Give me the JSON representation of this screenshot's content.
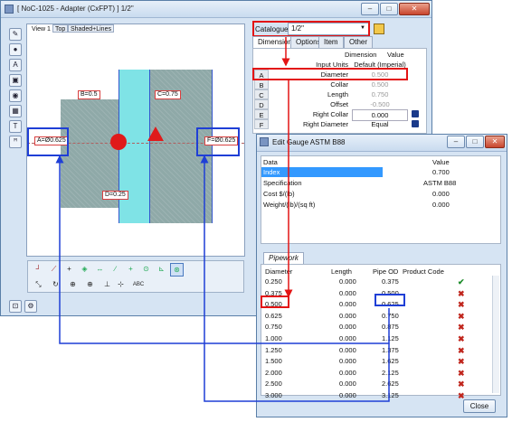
{
  "main_window": {
    "title": "[ NoC-1025 - Adapter (CxFPT) ] 1/2\"",
    "min_label": "–",
    "max_label": "□",
    "close_label": "✕"
  },
  "toolbar_icons": [
    "draw-icon",
    "sphere-icon",
    "text-icon",
    "camera-icon",
    "ball-icon",
    "grid-icon",
    "paint-icon",
    "brush-icon"
  ],
  "view": {
    "tabs": [
      "View 1",
      "Top",
      "Shaded+Lines"
    ],
    "dims": {
      "b": "B=0.5",
      "c": "C=0.75",
      "a": "A=Ø0.625",
      "f": "F=Ø0.625",
      "d": "D=0.25"
    }
  },
  "bottom_tools_row1": [
    "┘",
    "⟋",
    "+",
    "◈",
    "↔",
    "∕",
    "+",
    "⊙",
    "⊾",
    "⊛"
  ],
  "bottom_tools_row2": [
    "⤡",
    "↻",
    "⊕",
    "⊕",
    "⊥",
    "⊹",
    "ABC"
  ],
  "catalogue": {
    "label": "Catalogue",
    "value": "1/2\""
  },
  "dim_tabs": [
    "Dimensions",
    "Options",
    "Item",
    "Other"
  ],
  "dim_table": {
    "header_dimension": "Dimension",
    "header_value": "Value",
    "rows": [
      {
        "key": "",
        "name": "Input Units",
        "value": "Default (Imperial)"
      },
      {
        "key": "A",
        "name": "Diameter",
        "value": "0.500"
      },
      {
        "key": "B",
        "name": "Collar",
        "value": "0.500"
      },
      {
        "key": "C",
        "name": "Length",
        "value": "0.750"
      },
      {
        "key": "D",
        "name": "Offset",
        "value": "-0.500"
      },
      {
        "key": "E",
        "name": "Right Collar",
        "value": "0.000"
      },
      {
        "key": "F",
        "name": "Right Diameter",
        "value": "Equal"
      }
    ]
  },
  "gauge": {
    "title": "Edit Gauge ASTM B88",
    "data_header": "Data",
    "value_header": "Value",
    "rows": [
      {
        "name": "Index",
        "value": "0.700"
      },
      {
        "name": "Specification",
        "value": "ASTM B88"
      },
      {
        "name": "Cost $/(lb)",
        "value": "0.000"
      },
      {
        "name": "Weight/(lb)/(sq ft)",
        "value": "0.000"
      }
    ],
    "pipework_tab": "Pipework",
    "pw_headers": [
      "Diameter",
      "Length",
      "Pipe OD",
      "Product Code"
    ],
    "pw_rows": [
      {
        "d": "0.250",
        "l": "0.000",
        "od": "0.375",
        "mark": "✔"
      },
      {
        "d": "0.375",
        "l": "0.000",
        "od": "0.500",
        "mark": "✖"
      },
      {
        "d": "0.500",
        "l": "0.000",
        "od": "0.625",
        "mark": "✖"
      },
      {
        "d": "0.625",
        "l": "0.000",
        "od": "0.750",
        "mark": "✖"
      },
      {
        "d": "0.750",
        "l": "0.000",
        "od": "0.875",
        "mark": "✖"
      },
      {
        "d": "1.000",
        "l": "0.000",
        "od": "1.125",
        "mark": "✖"
      },
      {
        "d": "1.250",
        "l": "0.000",
        "od": "1.375",
        "mark": "✖"
      },
      {
        "d": "1.500",
        "l": "0.000",
        "od": "1.625",
        "mark": "✖"
      },
      {
        "d": "2.000",
        "l": "0.000",
        "od": "2.125",
        "mark": "✖"
      },
      {
        "d": "2.500",
        "l": "0.000",
        "od": "2.625",
        "mark": "✖"
      },
      {
        "d": "3.000",
        "l": "0.000",
        "od": "3.125",
        "mark": "✖"
      }
    ],
    "close_label": "Close"
  },
  "colors": {
    "annotation_red": "#e31414",
    "annotation_blue": "#1f3fd6",
    "pipe_cyan": "#7fe3e6",
    "selection": "#3399ff"
  }
}
